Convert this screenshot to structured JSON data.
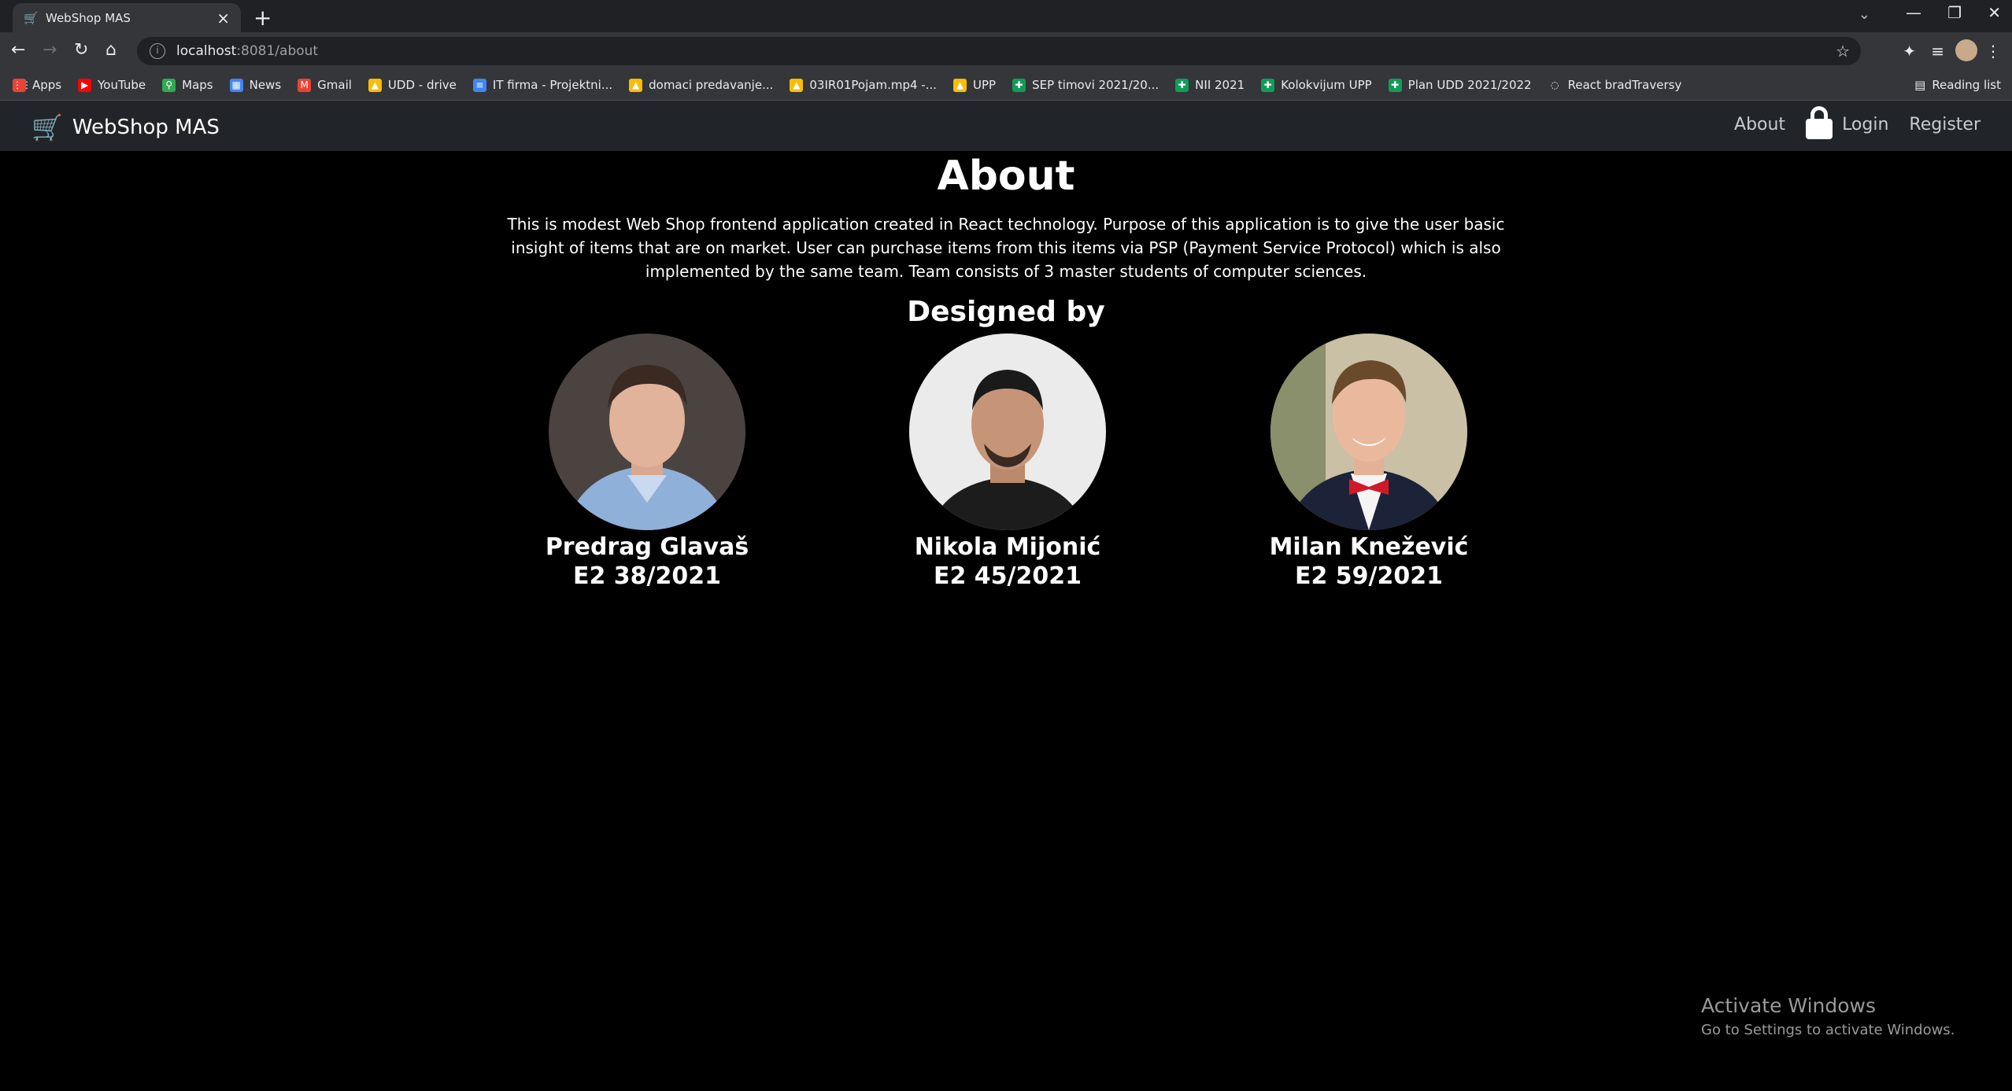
{
  "browser": {
    "tab_title": "WebShop MAS",
    "url_host": "localhost",
    "url_path": ":8081/about",
    "bookmarks": [
      {
        "label": "Apps",
        "icon": "apps-grid-icon",
        "color": "#ea4335"
      },
      {
        "label": "YouTube",
        "icon": "youtube-icon",
        "color": "#ff0000"
      },
      {
        "label": "Maps",
        "icon": "maps-pin-icon",
        "color": "#34a853"
      },
      {
        "label": "News",
        "icon": "news-icon",
        "color": "#4285f4"
      },
      {
        "label": "Gmail",
        "icon": "gmail-icon",
        "color": "#ea4335"
      },
      {
        "label": "UDD - drive",
        "icon": "drive-icon",
        "color": "#fbbc04"
      },
      {
        "label": "IT firma - Projektni...",
        "icon": "docs-icon",
        "color": "#4285f4"
      },
      {
        "label": "domaci predavanje...",
        "icon": "drive-icon",
        "color": "#fbbc04"
      },
      {
        "label": "03IR01Pojam.mp4 -...",
        "icon": "drive-icon",
        "color": "#fbbc04"
      },
      {
        "label": "UPP",
        "icon": "drive-icon",
        "color": "#fbbc04"
      },
      {
        "label": "SEP timovi 2021/20...",
        "icon": "sheets-icon",
        "color": "#0f9d58"
      },
      {
        "label": "NII 2021",
        "icon": "sheets-icon",
        "color": "#0f9d58"
      },
      {
        "label": "Kolokvijum UPP",
        "icon": "sheets-icon",
        "color": "#0f9d58"
      },
      {
        "label": "Plan UDD 2021/2022",
        "icon": "sheets-icon",
        "color": "#0f9d58"
      },
      {
        "label": "React bradTraversy",
        "icon": "globe-icon",
        "color": "#35363a"
      }
    ],
    "reading_list": "Reading list"
  },
  "navbar": {
    "brand": "WebShop MAS",
    "about": "About",
    "login": "Login",
    "register": "Register"
  },
  "page": {
    "title": "About",
    "description": "This is modest Web Shop frontend application created in React technology. Purpose of this application is to give the user basic insight of items that are on market. User can purchase items from this items via PSP (Payment Service Protocol) which is also implemented by the same team. Team consists of 3 master students of computer sciences.",
    "designed_by": "Designed by",
    "members": [
      {
        "name": "Predrag Glavaš",
        "index": "E2 38/2021"
      },
      {
        "name": "Nikola Mijonić",
        "index": "E2 45/2021"
      },
      {
        "name": "Milan Knežević",
        "index": "E2 59/2021"
      }
    ]
  },
  "watermark": {
    "line1": "Activate Windows",
    "line2": "Go to Settings to activate Windows."
  }
}
